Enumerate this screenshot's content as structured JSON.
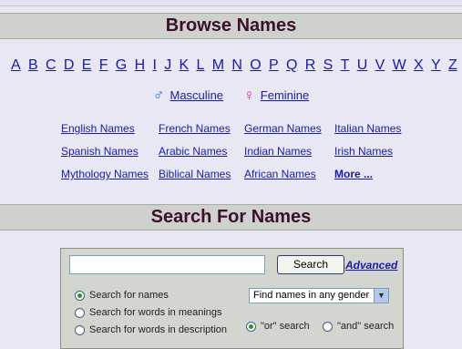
{
  "browse": {
    "title": "Browse Names",
    "letters": [
      "A",
      "B",
      "C",
      "D",
      "E",
      "F",
      "G",
      "H",
      "I",
      "J",
      "K",
      "L",
      "M",
      "N",
      "O",
      "P",
      "Q",
      "R",
      "S",
      "T",
      "U",
      "V",
      "W",
      "X",
      "Y",
      "Z"
    ],
    "masculine": "Masculine",
    "feminine": "Feminine",
    "categories": [
      "English Names",
      "French Names",
      "German Names",
      "Italian Names",
      "Spanish Names",
      "Arabic Names",
      "Indian Names",
      "Irish Names",
      "Mythology Names",
      "Biblical Names",
      "African Names",
      "More ..."
    ]
  },
  "search": {
    "title": "Search For Names",
    "input_value": "",
    "button_label": "Search",
    "advanced_label": "Advanced",
    "option_names": "Search for names",
    "option_meanings": "Search for words in meanings",
    "option_description": "Search for words in description",
    "gender_select": "Find names in any gender",
    "or_search": "\"or\" search",
    "and_search": "\"and\" search"
  },
  "icons": {
    "masculine": "male-symbol-icon",
    "feminine": "female-symbol-icon"
  },
  "colors": {
    "link": "#1a1aa6",
    "heading": "#3c0f2a",
    "bar": "#cfd2cc",
    "male": "#2f6fce",
    "female": "#d3358f"
  }
}
